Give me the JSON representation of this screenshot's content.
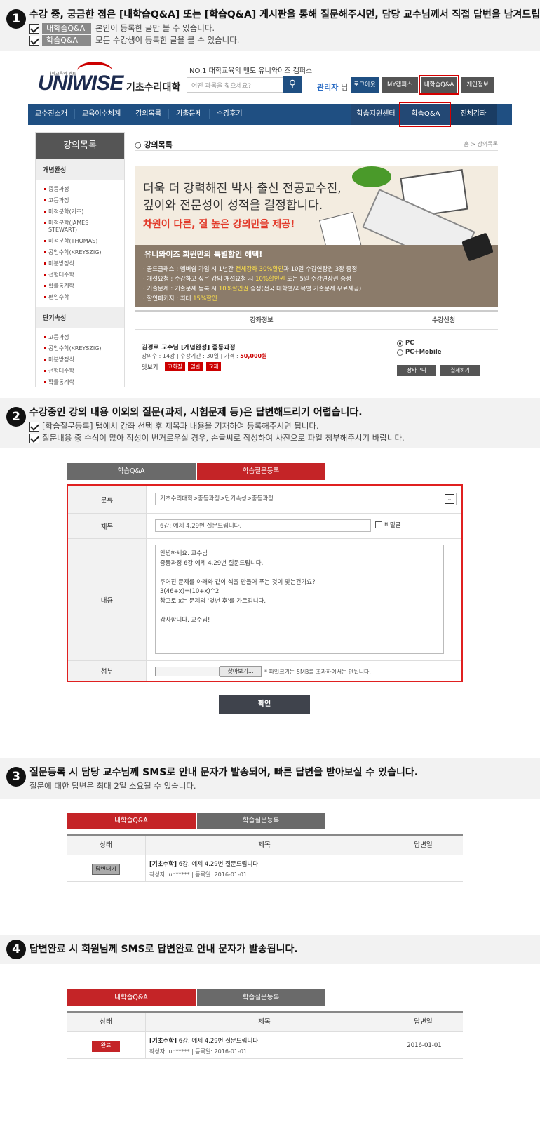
{
  "steps": [
    {
      "num": "1",
      "title": "수강 중, 궁금한 점은 [내학습Q&A] 또는 [학습Q&A] 게시판을 통해 질문해주시면, 담당 교수님께서 직접 답변을 남겨드립니다.",
      "lines": [
        {
          "tag": "내학습Q&A",
          "text": "본인이 등록한 글만 볼 수 있습니다."
        },
        {
          "tag": "학습Q&A",
          "text": "모든 수강생이 등록한 글을 볼 수 있습니다."
        }
      ]
    },
    {
      "num": "2",
      "title": "수강중인 강의 내용 이외의 질문(과제, 시험문제 등)은 답변해드리기 어렵습니다.",
      "lines": [
        "[학습질문등록] 탭에서 강좌 선택 후 제목과 내용을 기재하여 등록해주시면 됩니다.",
        "질문내용 중 수식이 많아 작성이 번거로우실 경우, 손글씨로 작성하여 사진으로 파일 첨부해주시기 바랍니다."
      ]
    },
    {
      "num": "3",
      "title": "질문등록 시 담당 교수님께 SMS로 안내 문자가 발송되어, 빠른 답변을 받아보실 수 있습니다.",
      "sub": "질문에 대한 답변은 최대  2일 소요될 수 있습니다."
    },
    {
      "num": "4",
      "title": "답변완료 시 회원님께 SMS로 답변완료 안내 문자가 발송됩니다."
    }
  ],
  "site": {
    "logo_sub": "대학교육의 멘토",
    "logo": "UNIWISE",
    "univ": "기초수리대학",
    "slogan": "NO.1 대학교육의 멘토 유니와이즈 캠퍼스",
    "search_placeholder": "어떤 과목을 찾으세요?",
    "admin_name": "관리자",
    "admin_suffix": "님",
    "top_buttons": [
      "로그아웃",
      "MY캠퍼스",
      "내학습Q&A",
      "개인정보"
    ],
    "nav": [
      "교수진소개",
      "교육이수체계",
      "강의목록",
      "기출문제",
      "수강후기"
    ],
    "nav_right": [
      "학습지원센터",
      "학습Q&A",
      "전체강좌"
    ],
    "side_title": "강의목록",
    "side_cat1": "개념완성",
    "side_items1": [
      "중등과정",
      "고등과정",
      "미적분학(기초)",
      "미적분학(JAMES STEWART)",
      "미적분학(THOMAS)",
      "공업수학(KREYSZIG)",
      "미분방정식",
      "선형대수학",
      "확률통계학",
      "편입수학"
    ],
    "side_cat2": "단기속성",
    "side_items2": [
      "고등과정",
      "공업수학(KREYSZIG)",
      "미분방정식",
      "선형대수학",
      "확률통계학"
    ],
    "page_title": "강의목록",
    "crumb": "홈 > 강의목록",
    "banner_l1": "더욱 더 강력해진 박사 출신 전공교수진,",
    "banner_l2": "깊이와 전문성이 성적을 결정합니다.",
    "banner_l3": "차원이 다른, 질 높은 강의만을 제공!",
    "banner_box_title": "유니와이즈 회원만의 특별할인 혜택!",
    "banner_lines": [
      {
        "k": "· 골드클래스 :",
        "a": " 멤버쉽 가입 시 1년간 ",
        "b": "전체강좌 30%할인",
        "c": "과 10일 수강연장권 3장 증정"
      },
      {
        "k": "· 개설요청 :",
        "a": " 수강하고 싶은 강의 개설요청 시 ",
        "b": "10%할인권",
        "c": " 또는 5일 수강연장권 증정"
      },
      {
        "k": "· 기출문제 :",
        "a": " 기출문제 등록 시 ",
        "b": "10%할인권",
        "c": " 증정(전국 대학별/과목별 기출문제 무료제공)"
      },
      {
        "k": "· 할인패키지 :",
        "a": " 최대 ",
        "b": "15%할인",
        "c": ""
      }
    ],
    "course_head_info": "강좌정보",
    "course_head_apply": "수강신청",
    "course_prof": "김경로 교수님 [개념완성] 중등과정",
    "course_info": "강의수 : 14강 | 수강기간 : 30일 | 가격 : ",
    "course_price": "50,000원",
    "preview_label": "맛보기 :",
    "preview_links": [
      "고화질",
      "일반",
      "교재"
    ],
    "radio_pc": "PC",
    "radio_pcm": "PC+Mobile",
    "cart_btn": "장바구니",
    "pay_btn": "결제하기"
  },
  "tabs": {
    "qa": "학습Q&A",
    "register": "학습질문등록",
    "my": "내학습Q&A"
  },
  "form": {
    "category_label": "분류",
    "category_value": "기초수리대학>중등과정>단기속성>중등과정",
    "title_label": "제목",
    "title_value": "6강: 예제 4.29번 질문드립니다.",
    "secret_label": "비밀글",
    "content_label": "내용",
    "content_value": "안녕하세요. 교수님\n중등과정 6강 예제 4.29번 질문드립니다.\n\n주어진 문제를 아래와 같이 식을 만들어 푸는 것이 맞는건가요?\n3(46+x)=(10+x)^2\n참고로 x는 문제의 '몇년 후'를 가르킵니다.\n\n감사합니다. 교수님!",
    "file_label": "첨부",
    "file_button": "찾아보기...",
    "file_note": "* 파일크기는 5MB를 초과하여서는 안됩니다.",
    "confirm": "확인"
  },
  "list": {
    "col_status": "상태",
    "col_title": "제목",
    "col_date": "답변일",
    "row_prefix": "[기초수학]",
    "row_title": " 6강. 예제 4.29번 질문드립니다.",
    "row_meta": "작성자: un*****   |   등록일: 2016-01-01",
    "status_wait": "답변대기",
    "status_done": "완료",
    "answer_date": "2016-01-01"
  }
}
